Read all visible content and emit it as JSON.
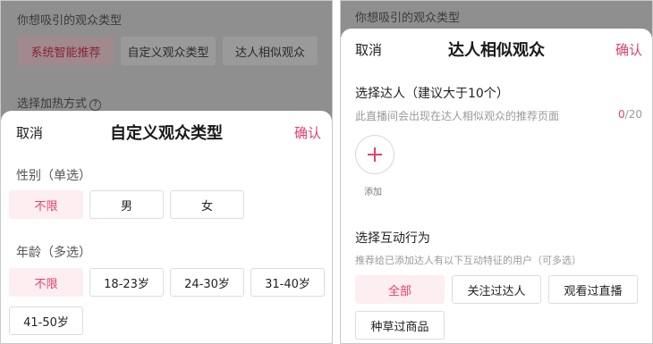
{
  "left": {
    "background": {
      "section_title": "你想吸引的观众类型",
      "chips": [
        "系统智能推荐",
        "自定义观众类型",
        "达人相似观众"
      ],
      "heat_method_label": "选择加热方式",
      "help_icon": "?"
    },
    "sheet": {
      "cancel_label": "取消",
      "title": "自定义观众类型",
      "confirm_label": "确认",
      "gender": {
        "label": "性别（单选）",
        "options": [
          {
            "label": "不限",
            "selected": true
          },
          {
            "label": "男",
            "selected": false
          },
          {
            "label": "女",
            "selected": false
          }
        ]
      },
      "age": {
        "label": "年龄（多选）",
        "options": [
          {
            "label": "不限",
            "selected": true
          },
          {
            "label": "18-23岁",
            "selected": false
          },
          {
            "label": "24-30岁",
            "selected": false
          },
          {
            "label": "31-40岁",
            "selected": false
          },
          {
            "label": "41-50岁",
            "selected": false
          }
        ]
      }
    }
  },
  "right": {
    "background": {
      "section_title": "你想吸引的观众类型"
    },
    "sheet": {
      "cancel_label": "取消",
      "title": "达人相似观众",
      "confirm_label": "确认",
      "select_creator": {
        "label": "选择达人（建议大于10个）",
        "hint": "此直播间会出现在达人相似观众的推荐页面",
        "count": "0",
        "count_sep": "/",
        "max": "20",
        "add_label": "添加"
      },
      "interaction": {
        "label": "选择互动行为",
        "hint": "推荐给已添加达人有以下互动特征的用户（可多选）",
        "options": [
          {
            "label": "全部",
            "selected": true
          },
          {
            "label": "关注过达人",
            "selected": false
          },
          {
            "label": "观看过直播",
            "selected": false
          },
          {
            "label": "种草过商品",
            "selected": false
          }
        ]
      }
    }
  },
  "colors": {
    "accent": "#e1416a",
    "selected_bg": "#fdeef1",
    "overlay": "#8f8f8f"
  },
  "icons": {
    "add": "plus-icon",
    "help": "help-circle-icon"
  }
}
